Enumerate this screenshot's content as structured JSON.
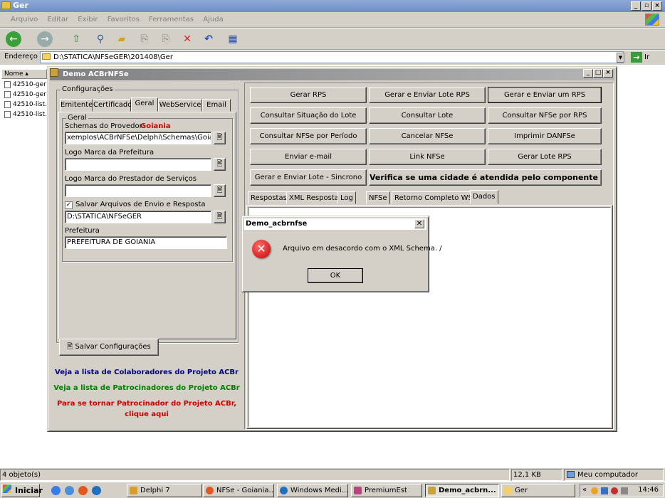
{
  "explorer": {
    "title": "Ger",
    "menu": [
      "Arquivo",
      "Editar",
      "Exibir",
      "Favoritos",
      "Ferramentas",
      "Ajuda"
    ],
    "address_label": "Endereço",
    "address_value": "D:\\STATICA\\NFSeGER\\201408\\Ger",
    "go_label": "Ir",
    "column_name": "Nome",
    "files": [
      "42510-ger",
      "42510-ger",
      "42510-list.",
      "42510-list."
    ],
    "status_left": "4 objeto(s)",
    "status_size": "12,1 KB",
    "status_location": "Meu computador"
  },
  "app": {
    "title": "Demo ACBrNFSe",
    "config_group": "Configurações",
    "tabs": [
      "Emitente",
      "Certificado",
      "Geral",
      "WebService",
      "Email"
    ],
    "geral_group": "Geral",
    "schemas_label": "Schemas do Provedor:",
    "provider_name": "Goiania",
    "schemas_value": "xemplos\\ACBrNFSe\\Delphi\\Schemas\\Goiania",
    "logo_prefeitura_label": "Logo Marca da Prefeitura",
    "logo_prefeitura_value": "",
    "logo_prestador_label": "Logo Marca do Prestador de Serviços",
    "logo_prestador_value": "",
    "salvar_arquivos_label": "Salvar Arquivos de Envio e Resposta",
    "salvar_arquivos_checked": "✓",
    "salvar_path": "D:\\STATICA\\NFSeGER",
    "prefeitura_label": "Prefeitura",
    "prefeitura_value": "PREFEITURA DE GOIANIA",
    "browse_glyph": "🖹",
    "save_config_label": "Salvar Configurações",
    "link_colaboradores": "Veja a lista de Colaboradores do Projeto ACBr",
    "link_patrocinadores": "Veja a lista de Patrocinadores do Projeto ACBr",
    "link_patrocinador_1": "Para se tornar Patrocinador do Projeto ACBr,",
    "link_patrocinador_2": "clique aqui",
    "colors": {
      "provider": "#cc0000",
      "colaboradores": "#000080",
      "patrocinadores": "#008000",
      "patrocinador": "#cc0000"
    },
    "buttons": [
      [
        "Gerar RPS",
        "Gerar e Enviar Lote RPS",
        "Gerar e Enviar um RPS"
      ],
      [
        "Consultar Situação do Lote",
        "Consultar Lote",
        "Consultar NFSe por RPS"
      ],
      [
        "Consultar NFSe por Período",
        "Cancelar NFSe",
        "Imprimir DANFSe"
      ],
      [
        "Enviar e-mail",
        "Link NFSe",
        "Gerar Lote RPS"
      ]
    ],
    "btn_sincrono": "Gerar e Enviar Lote - Sincrono",
    "btn_cidade": "Verifica se uma cidade é atendida pelo componente ou não",
    "result_tabs": [
      "Respostas",
      "XML Resposta",
      "Log",
      "NFSe",
      "Retorno Completo WS",
      "Dados"
    ]
  },
  "dialog": {
    "title": "Demo_acbrnfse",
    "message": "Arquivo em desacordo com o XML Schema. /",
    "ok_label": "OK",
    "close": "✕",
    "icon_glyph": "✕"
  },
  "taskbar": {
    "start": "Iniciar",
    "items": [
      "Delphi 7",
      "NFSe - Goiania...",
      "Windows Medi...",
      "PremiumEst",
      "Demo_acbrn...",
      "Ger"
    ],
    "clock": "14:46",
    "tray_arrow": "«"
  }
}
